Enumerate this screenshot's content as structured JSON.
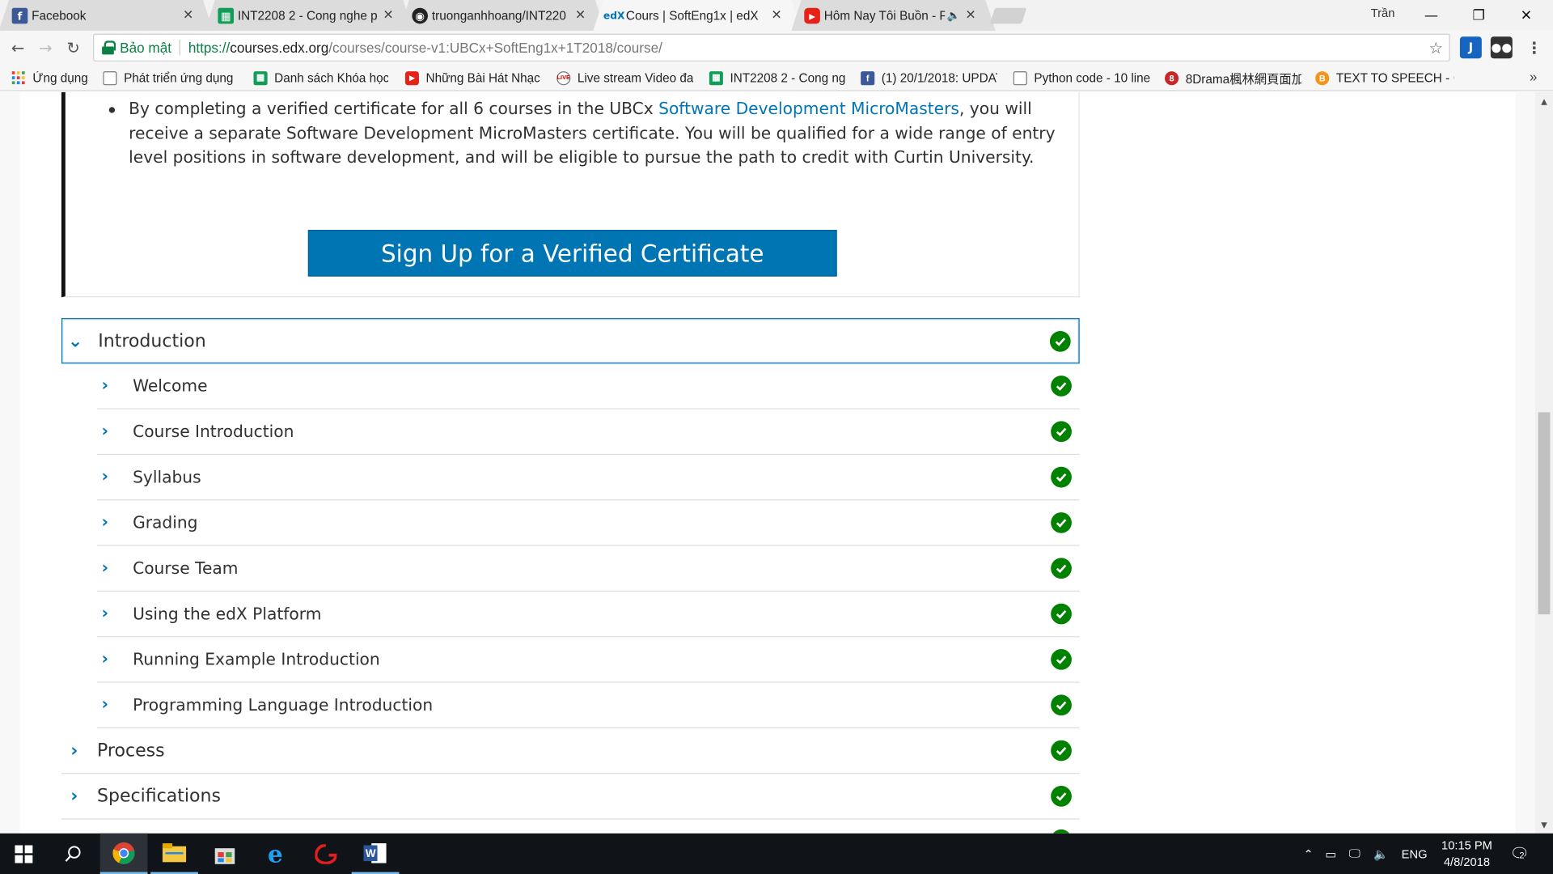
{
  "browser": {
    "tabs": [
      {
        "title": "Facebook",
        "icon": "facebook-icon",
        "active": false
      },
      {
        "title": "INT2208 2 - Cong nghe p",
        "icon": "sheets-icon",
        "active": false
      },
      {
        "title": "truonganhhoang/INT220",
        "icon": "github-icon",
        "active": false
      },
      {
        "title": "Cours | SoftEng1x | edX",
        "icon": "edx-icon",
        "active": true
      },
      {
        "title": "Hôm Nay Tôi Buồn - P",
        "icon": "youtube-icon",
        "active": false,
        "audio": true
      }
    ],
    "user_name": "Trần",
    "omnibox": {
      "secure_label": "Bảo mật",
      "url_scheme": "https://",
      "url_host": "courses.edx.org",
      "url_path": "/courses/course-v1:UBCx+SoftEng1x+1T2018/course/"
    },
    "bookmarks": [
      {
        "label": "Ứng dụng",
        "icon": "apps-grid-icon"
      },
      {
        "label": "Phát triển ứng dụng w",
        "icon": "page-icon"
      },
      {
        "label": "Danh sách Khóa học",
        "icon": "sheets-icon"
      },
      {
        "label": "Những Bài Hát Nhạc",
        "icon": "youtube-icon"
      },
      {
        "label": "Live stream Video đa",
        "icon": "live-icon"
      },
      {
        "label": "INT2208 2 - Cong ngh",
        "icon": "sheets-icon"
      },
      {
        "label": "(1) 20/1/2018: UPDAT",
        "icon": "facebook-icon"
      },
      {
        "label": "Python code - 10 line",
        "icon": "page-icon"
      },
      {
        "label": "8Drama楓林網頁面加",
        "icon": "drama-icon"
      },
      {
        "label": "TEXT TO SPEECH - CH",
        "icon": "bitcoin-icon"
      }
    ]
  },
  "course": {
    "certificate_text_before": "By completing a verified certificate for all 6 courses in the UBCx ",
    "certificate_link": "Software Development MicroMasters",
    "certificate_text_after": ", you will receive a separate Software Development MicroMasters certificate. You will be qualified for a wide range of entry level positions in software development, and will be eligible to pursue the path to credit with Curtin University.",
    "signup_button": "Sign Up for a Verified Certificate",
    "sections": [
      {
        "title": "Introduction",
        "expanded": true,
        "complete": true,
        "subsections": [
          {
            "title": "Welcome",
            "complete": true
          },
          {
            "title": "Course Introduction",
            "complete": true
          },
          {
            "title": "Syllabus",
            "complete": true
          },
          {
            "title": "Grading",
            "complete": true
          },
          {
            "title": "Course Team",
            "complete": true
          },
          {
            "title": "Using the edX Platform",
            "complete": true
          },
          {
            "title": "Running Example Introduction",
            "complete": true
          },
          {
            "title": "Programming Language Introduction",
            "complete": true
          }
        ]
      },
      {
        "title": "Process",
        "expanded": false,
        "complete": true
      },
      {
        "title": "Specifications",
        "expanded": false,
        "complete": true
      }
    ]
  },
  "taskbar": {
    "apps": [
      "windows-start-icon",
      "search-icon",
      "chrome-icon",
      "file-explorer-icon",
      "store-icon",
      "internet-explorer-icon",
      "garena-icon",
      "word-icon"
    ],
    "language": "ENG",
    "time": "10:15 PM",
    "date": "4/8/2018",
    "notifications": "2"
  },
  "colors": {
    "edx_blue": "#0075b4",
    "complete_green": "#008100",
    "taskbar": "#101418"
  }
}
